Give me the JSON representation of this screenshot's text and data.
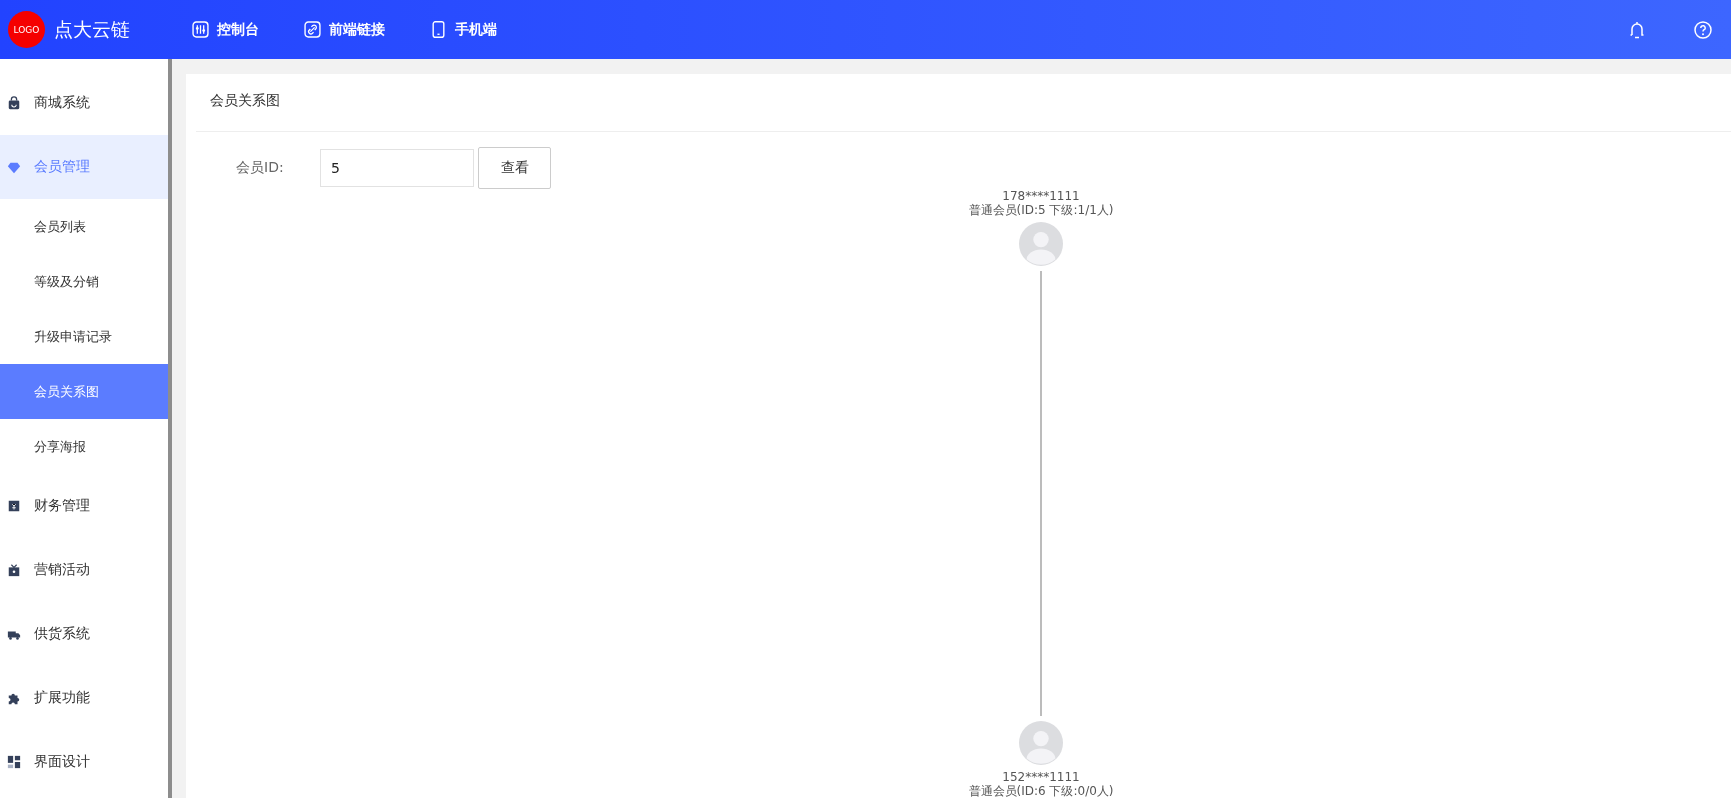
{
  "header": {
    "logo": "LOGO",
    "brand": "点大云链",
    "nav": [
      {
        "label": "控制台",
        "kind": "console"
      },
      {
        "label": "前端链接",
        "kind": "link"
      },
      {
        "label": "手机端",
        "kind": "phone"
      }
    ]
  },
  "sidebar": {
    "items": [
      {
        "label": "商城系统",
        "kind": "bag",
        "selected": false
      },
      {
        "label": "会员管理",
        "kind": "gem",
        "selected": true,
        "children": [
          {
            "label": "会员列表",
            "selected": false
          },
          {
            "label": "等级及分销",
            "selected": false
          },
          {
            "label": "升级申请记录",
            "selected": false
          },
          {
            "label": "会员关系图",
            "selected": true
          },
          {
            "label": "分享海报",
            "selected": false
          }
        ]
      },
      {
        "label": "财务管理",
        "kind": "finance",
        "selected": false
      },
      {
        "label": "营销活动",
        "kind": "gift",
        "selected": false
      },
      {
        "label": "供货系统",
        "kind": "truck",
        "selected": false
      },
      {
        "label": "扩展功能",
        "kind": "puzzle",
        "selected": false
      },
      {
        "label": "界面设计",
        "kind": "layout",
        "selected": false
      }
    ]
  },
  "page": {
    "title": "会员关系图",
    "form": {
      "label": "会员ID:",
      "value": "5",
      "button": "查看"
    }
  },
  "tree": {
    "phone": "178****1111",
    "info": "普通会员(ID:5 下级:1/1人)",
    "children": [
      {
        "phone": "152****1111",
        "info": "普通会员(ID:6 下级:0/0人)"
      }
    ]
  }
}
